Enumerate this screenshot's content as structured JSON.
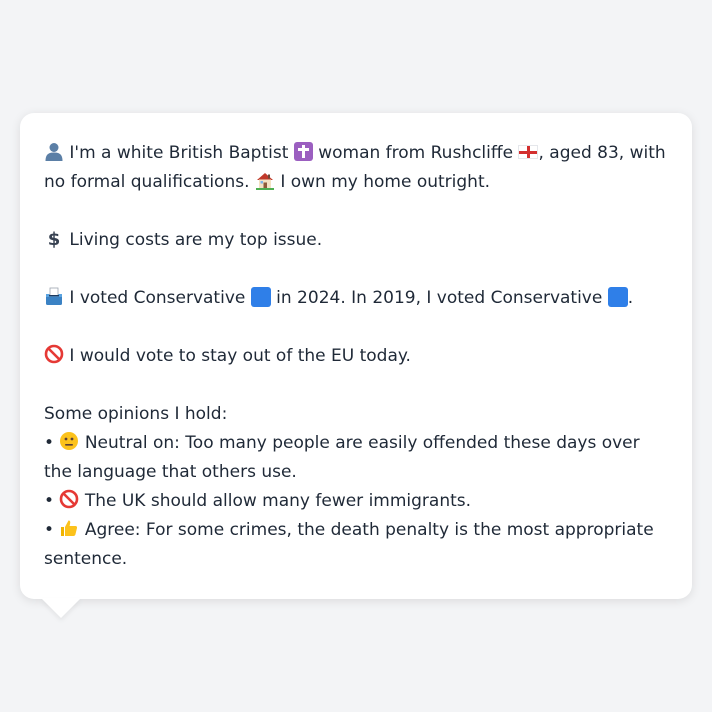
{
  "profile": {
    "intro_1": "I'm a white British Baptist",
    "intro_2": "woman from Rushcliffe",
    "intro_3": ", aged 83, with no formal qualifications.",
    "home": "I own my home outright.",
    "top_issue": "Living costs are my top issue.",
    "vote_1": "I voted Conservative",
    "vote_2": "in 2024. In 2019, I voted Conservative",
    "vote_3": ".",
    "eu": "I would vote to stay out of the EU today.",
    "opinions_heading": "Some opinions I hold:",
    "opinions": [
      "Neutral on: Too many people are easily offended these days over the language that others use.",
      "The UK should allow many fewer immigrants.",
      "Agree: For some crimes, the death penalty is the most appropriate sentence."
    ],
    "bullet": "•"
  },
  "icons": {
    "person": "person-icon",
    "cross": "latin-cross-icon",
    "flag": "england-flag-icon",
    "house": "house-icon",
    "dollar": "dollar-icon",
    "ballot": "ballot-box-icon",
    "blue_square": "blue-square-icon",
    "no_entry": "prohibited-icon",
    "neutral": "neutral-face-icon",
    "thumbs_up": "thumbs-up-icon"
  },
  "colors": {
    "background": "#f3f4f6",
    "bubble": "#ffffff",
    "text": "#1f2937",
    "conservative_blue": "#2f7fe8"
  }
}
